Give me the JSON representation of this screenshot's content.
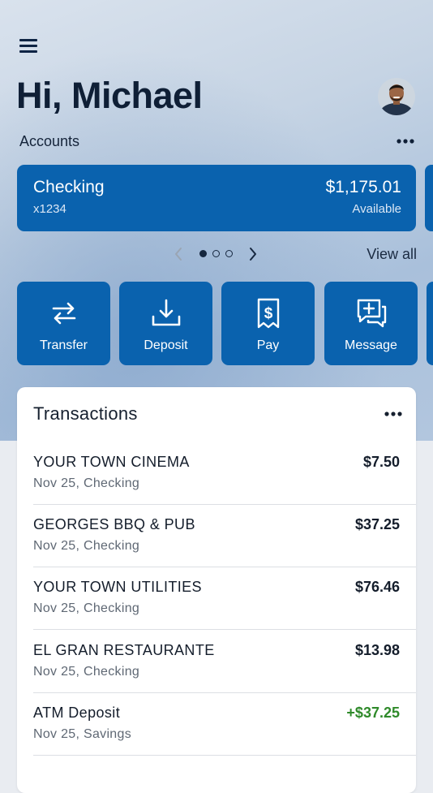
{
  "greeting": "Hi, Michael",
  "accounts": {
    "label": "Accounts",
    "card": {
      "name": "Checking",
      "number": "x1234",
      "balance": "$1,175.01",
      "balance_label": "Available"
    },
    "view_all": "View all",
    "pager": {
      "current": 1,
      "total": 3
    }
  },
  "actions": [
    {
      "label": "Transfer",
      "icon": "transfer-icon"
    },
    {
      "label": "Deposit",
      "icon": "deposit-icon"
    },
    {
      "label": "Pay",
      "icon": "pay-receipt-icon"
    },
    {
      "label": "Message",
      "icon": "message-icon"
    }
  ],
  "transactions": {
    "title": "Transactions",
    "items": [
      {
        "merchant": "YOUR TOWN CINEMA",
        "meta": "Nov 25, Checking",
        "amount": "$7.50"
      },
      {
        "merchant": "GEORGES BBQ & PUB",
        "meta": "Nov 25, Checking",
        "amount": "$37.25"
      },
      {
        "merchant": "YOUR TOWN UTILITIES",
        "meta": "Nov 25, Checking",
        "amount": "$76.46"
      },
      {
        "merchant": "EL GRAN RESTAURANTE",
        "meta": "Nov 25, Checking",
        "amount": "$13.98"
      },
      {
        "merchant": "ATM Deposit",
        "meta": "Nov 25, Savings",
        "amount": "+$37.25"
      }
    ]
  },
  "colors": {
    "brand_blue": "#0a62ae",
    "credit_green": "#2f8a2a",
    "text_dark": "#0f1f36"
  }
}
